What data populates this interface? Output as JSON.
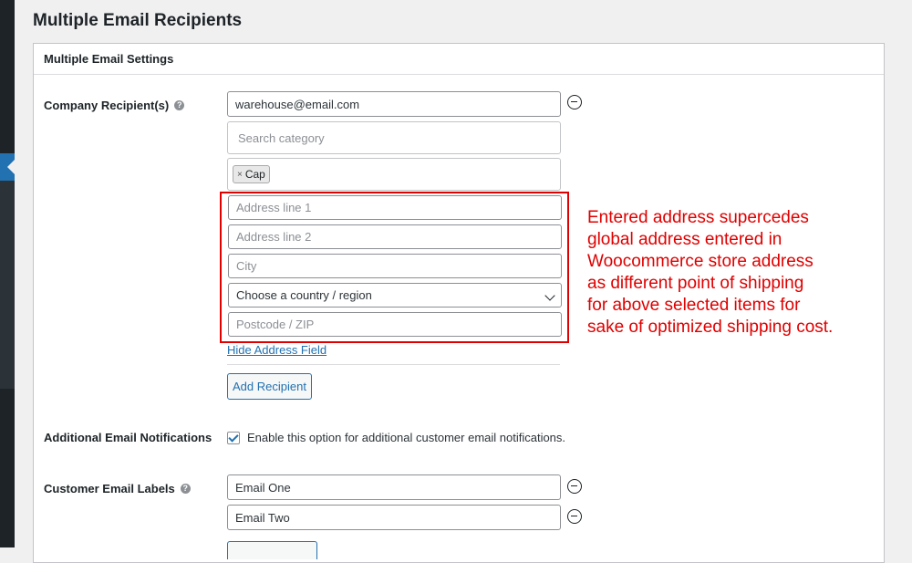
{
  "page": {
    "title": "Multiple Email Recipients"
  },
  "panel": {
    "title": "Multiple Email Settings"
  },
  "company": {
    "label": "Company Recipient(s)",
    "email_value": "warehouse@email.com",
    "search_placeholder": "Search category",
    "selected_tags": [
      "Cap"
    ],
    "address": {
      "line1_placeholder": "Address line 1",
      "line2_placeholder": "Address line 2",
      "city_placeholder": "City",
      "country_selected": "Choose a country / region",
      "postcode_placeholder": "Postcode / ZIP"
    },
    "hide_address_link": "Hide Address Field",
    "add_recipient_label": "Add Recipient"
  },
  "annotation": {
    "lines": [
      "Entered address supercedes",
      "global address entered in",
      "Woocommerce store address",
      "as different point of shipping",
      "for above selected items for",
      "sake of optimized shipping cost."
    ],
    "color": "#e00000"
  },
  "notifications": {
    "label": "Additional Email Notifications",
    "checkbox_checked": true,
    "checkbox_label": "Enable this option for additional customer email notifications."
  },
  "labels": {
    "label": "Customer Email Labels",
    "values": [
      "Email One",
      "Email Two"
    ]
  },
  "icons": {
    "help": "help-icon",
    "remove": "minus-circle-icon",
    "dropdown": "chevron-down-icon"
  },
  "colors": {
    "accent": "#2271b1",
    "admin_bar": "#1d2327"
  }
}
